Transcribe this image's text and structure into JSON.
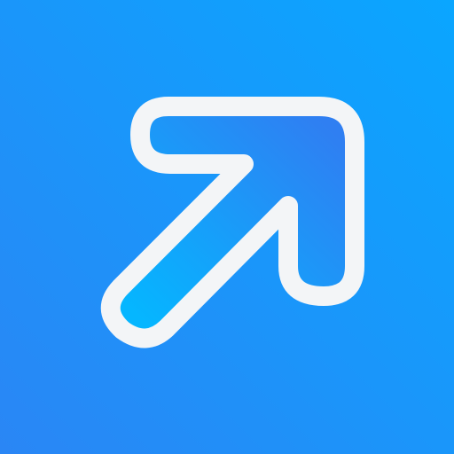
{
  "icon": {
    "name": "diagonal-up-right-arrow-icon",
    "colors": {
      "background_start": "#0aa6ff",
      "background_end": "#2a86f5",
      "arrow_fill_start": "#05b6ff",
      "arrow_fill_end": "#2f7ff2",
      "arrow_outline": "#f3f5f7"
    }
  }
}
